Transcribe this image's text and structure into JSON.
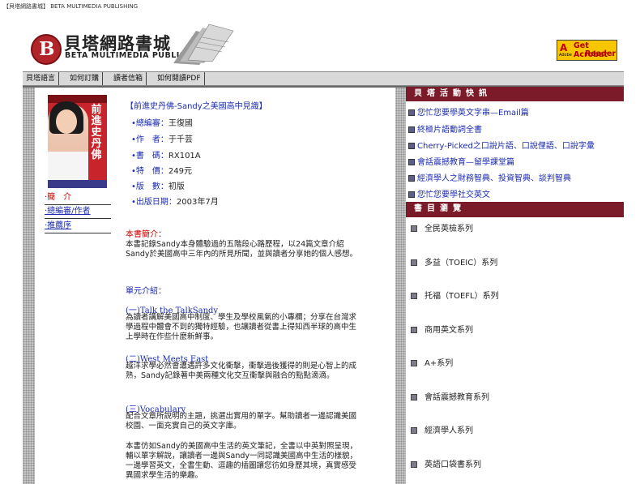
{
  "header": {
    "tiny_title": "【貝塔網路書城】 BETA MULTIMEDIA PUBLISHING",
    "logo_letter": "B",
    "logo_cn": "貝塔網路書城",
    "logo_en": "BETA MULTIMEDIA PUBLISHING"
  },
  "acrobat": {
    "line1": "Get Acrobat",
    "line2": "Reader",
    "brand": "Adobe"
  },
  "nav": [
    "貝塔語言",
    "如何訂購",
    "讀者信箱",
    "如何閱讀PDF"
  ],
  "cover": {
    "title": "前進史丹佛"
  },
  "left_menu": [
    {
      "label": "‧簡　介",
      "active": true
    },
    {
      "label": "‧總編審/作者",
      "active": false
    },
    {
      "label": "‧推薦序",
      "active": false
    }
  ],
  "book": {
    "title": "【前進史丹佛-Sandy之美國高中見識】",
    "fields": [
      {
        "label": "•總編審：",
        "value": "王復國"
      },
      {
        "label": "•作　者：",
        "value": "于千芸"
      },
      {
        "label": "•書　碼：",
        "value": "RX101A"
      },
      {
        "label": "•特　價：",
        "value": "249元"
      },
      {
        "label": "•版　數：",
        "value": "初版"
      },
      {
        "label": "•出版日期：",
        "value": "2003年7月"
      }
    ]
  },
  "intro": {
    "heading": "本書簡介：",
    "text": "本書記錄Sandy本身體驗過的五階段心路歷程，以24篇文章介紹Sandy於美國高中三年內的所見所聞，並與讀者分享她的個人感想。"
  },
  "units": {
    "heading": "單元介紹：",
    "items": [
      {
        "title": "(一)Talk the TalkSandy",
        "text": "為讀者講解美國高中制度、學生及學校風氣的小專欄；分享在台灣求學過程中體會不到的獨特經驗，也讓讀者從書上得知西半球的高中生上學時在作些什麼新鮮事。"
      },
      {
        "title": "(二)West Meets East",
        "text": "越洋求學必然會遭遇許多文化衝擊，衝擊過後獲得的則是心智上的成熟，Sandy記錄著中美兩種文化交互衝擊與融合的點點滴滴。"
      },
      {
        "title": "(三)Vocabulary",
        "text": "配合文章所說明的主題，挑選出實用的單字。幫助讀者一邊認識美國校園、一面充實自己的英文字庫。"
      }
    ],
    "closing": "本書仿如Sandy的美國高中生活的英文筆記，全書以中英對照呈現，輔以單字解說，讓讀者一邊與Sandy一同認識美國高中生活的樣貌，一邊學習英文，全書生動、逗趣的插圖讓您彷如身歷其境，真實感受異國求學生活的樂趣。"
  },
  "activities": {
    "heading": "貝塔活動快訊",
    "items": [
      "您忙您要學英文字串—Email篇",
      "終極片語動詞全書",
      "Cherry-Picked之口說片語、口說俚語、口說字彙",
      "會話震撼教育—留學課堂篇",
      "經濟學人之財務智典、投資智典、談判智典",
      "您忙您要學社交英文"
    ]
  },
  "browse": {
    "heading": "書目瀏覽",
    "items": [
      "全民英檢系列",
      "多益（TOEIC）系列",
      "托福（TOEFL）系列",
      "商用英文系列",
      "A+系列",
      "會話震撼教育系列",
      "經濟學人系列",
      "英語口袋書系列"
    ]
  }
}
